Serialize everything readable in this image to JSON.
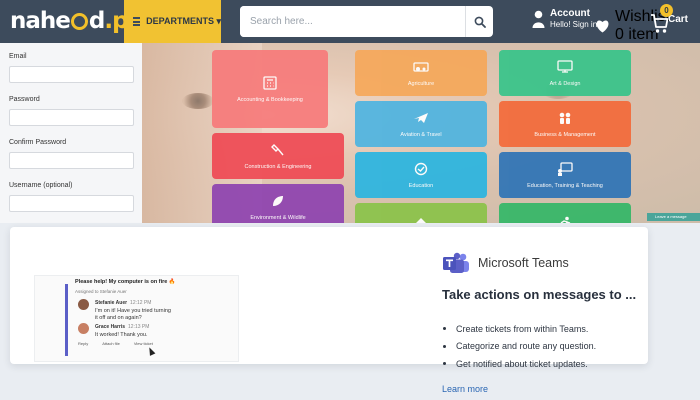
{
  "header": {
    "logo_text": "nahe",
    "logo_text_after": "d",
    "logo_suffix": ".pk",
    "departments_label": "DEPARTMENTS ▾",
    "search_placeholder": "Search here...",
    "account_title": "Account",
    "account_sub": "Hello! Sign in",
    "wishlist_title": "Wishlist",
    "wishlist_sub": "0 item",
    "cart_count": "0",
    "cart_label": "Cart"
  },
  "form": {
    "email_label": "Email",
    "password_label": "Password",
    "confirm_label": "Confirm Password",
    "username_label": "Username (optional)"
  },
  "categories": [
    {
      "label": "Accounting & Bookkeeping",
      "color": "#f77b7b",
      "icon": "calculator-icon"
    },
    {
      "label": "Agriculture",
      "color": "#f5a85a",
      "icon": "tractor-icon"
    },
    {
      "label": "Art & Design",
      "color": "#38c48a",
      "icon": "monitor-icon"
    },
    {
      "label": "Aviation & Travel",
      "color": "#4fb4e0",
      "icon": "plane-icon"
    },
    {
      "label": "Business & Management",
      "color": "#f36a3a",
      "icon": "people-icon"
    },
    {
      "label": "Construction & Engineering",
      "color": "#ef4b55",
      "icon": "tool-icon"
    },
    {
      "label": "Education",
      "color": "#2bb5e0",
      "icon": "graduation-icon"
    },
    {
      "label": "Education, Training & Teaching",
      "color": "#2f74b6",
      "icon": "board-icon"
    },
    {
      "label": "Environment & Wildlife",
      "color": "#8f44b0",
      "icon": "leaf-icon"
    },
    {
      "label": "",
      "color": "#8bc34a",
      "icon": "arrow-up-icon"
    },
    {
      "label": "",
      "color": "#35b768",
      "icon": "runner-icon"
    }
  ],
  "chip_text": "Leave a message",
  "teams_shot": {
    "title": "Please help! My computer is on fire 🔥",
    "assigned": "Assigned to Stefanie Auer",
    "msg1_author": "Stefanie Auer",
    "msg1_time": "12:12 PM",
    "msg1_line1": "I'm on it! Have you tried turning",
    "msg1_line2": "it off and on again?",
    "msg2_author": "Grace Harris",
    "msg2_time": "12:13 PM",
    "msg2_text": "It worked! Thank you.",
    "action1": "Reply",
    "action2": "Attach file",
    "action3": "View ticket"
  },
  "teams": {
    "brand": "Microsoft Teams",
    "heading": "Take actions on messages to ...",
    "bullets": [
      "Create tickets from within Teams.",
      "Categorize and route any question.",
      "Get notified about ticket updates."
    ],
    "learn_more": "Learn more"
  },
  "colors": {
    "header_bg": "#3d4b5c",
    "accent": "#f1c232",
    "teams_purple": "#5b5fc7",
    "link": "#2a66b3"
  }
}
